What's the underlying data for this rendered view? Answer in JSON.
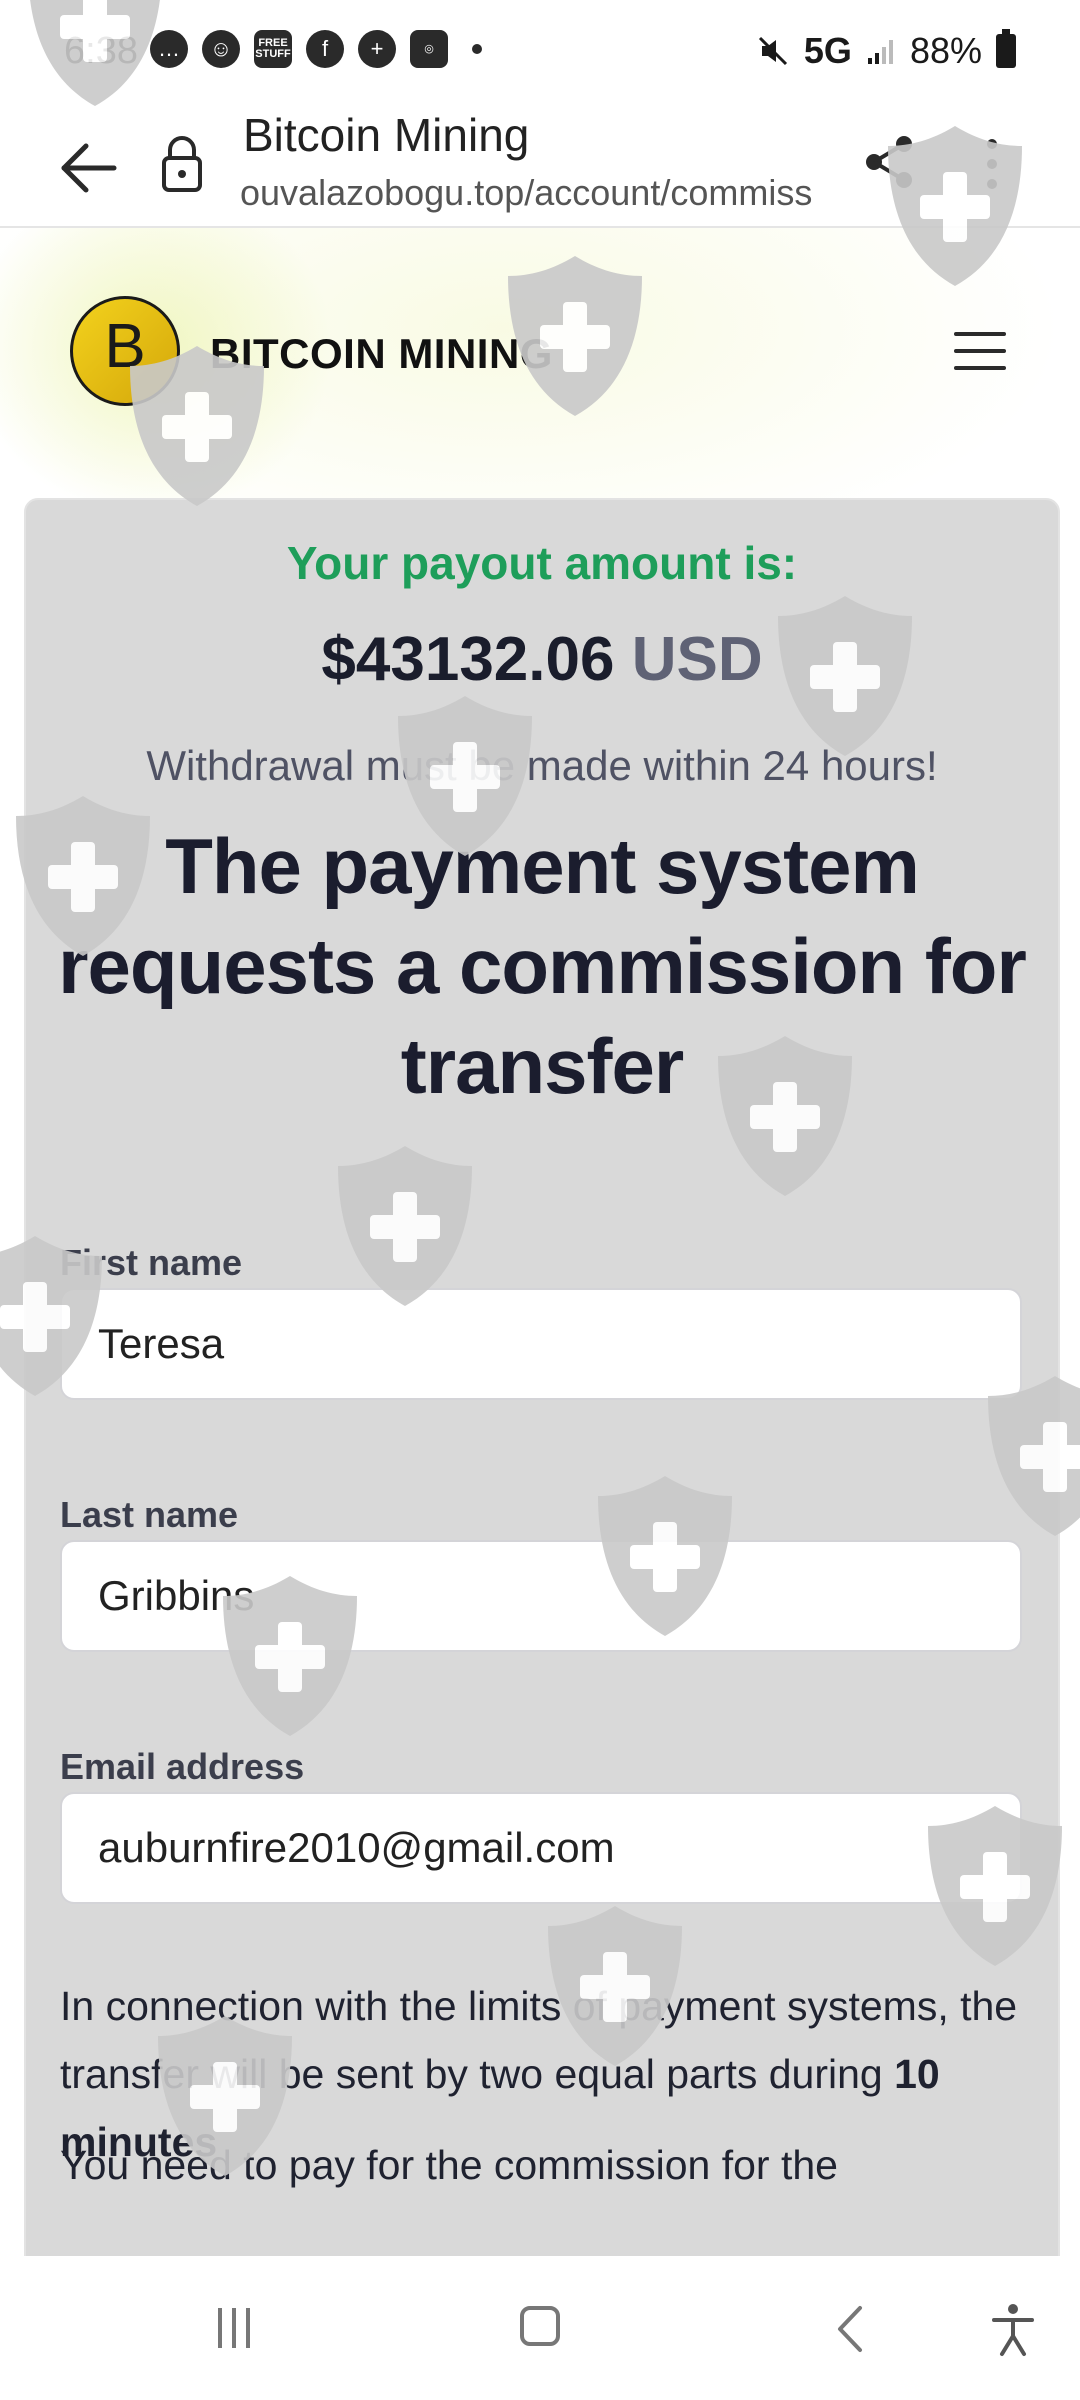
{
  "status_bar": {
    "time": "6:38",
    "network": "5G",
    "battery": "88%",
    "free_stuff_icon_text": "FREE STUFF"
  },
  "browser": {
    "page_title": "Bitcoin Mining",
    "url": "ouvalazobogu.top/account/commiss"
  },
  "site": {
    "brand": "BITCOIN MINING",
    "logo_letter": "B"
  },
  "payout": {
    "label": "Your payout amount is:",
    "amount": "$43132.06",
    "currency": "USD",
    "note": "Withdrawal must be made within 24 hours!"
  },
  "headline": "The payment system requests a commission for transfer",
  "form": {
    "first_name_label": "First name",
    "first_name_value": "Teresa",
    "last_name_label": "Last name",
    "last_name_value": "Gribbins",
    "email_label": "Email address",
    "email_value": "auburnfire2010@gmail.com"
  },
  "info": {
    "text_before": "In connection with the limits of payment systems, the transfer will be sent by two equal parts during ",
    "text_bold": "10 minutes",
    "cut_line": "You need to pay for the commission for the"
  },
  "colors": {
    "payout_green": "#1e9e5a",
    "headline": "#1b1d2e",
    "logo_gold": "#f3d21d"
  }
}
